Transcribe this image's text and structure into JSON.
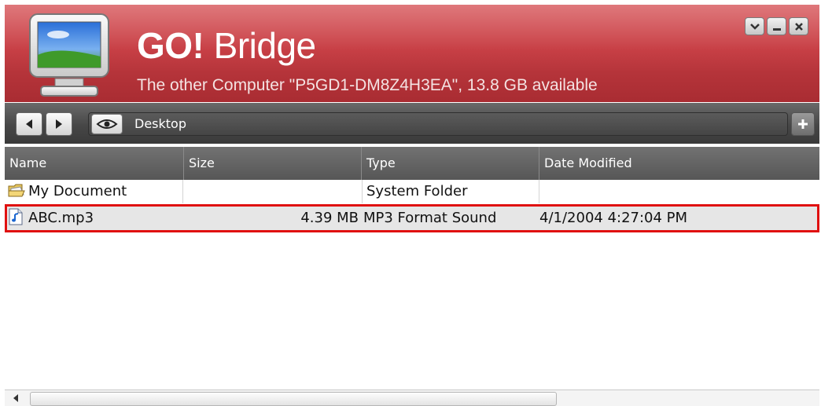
{
  "window": {
    "title_bold": "GO!",
    "title_rest": " Bridge",
    "subtitle": "The other Computer \"P5GD1-DM8Z4H3EA\", 13.8 GB available",
    "accent_color": "#c84046"
  },
  "toolbar": {
    "path": "Desktop"
  },
  "columns": [
    {
      "label": "Name"
    },
    {
      "label": "Size"
    },
    {
      "label": "Type"
    },
    {
      "label": "Date Modified"
    }
  ],
  "rows": [
    {
      "name": "My Document",
      "size": "",
      "type": "System Folder",
      "date": "",
      "icon": "folder-icon"
    },
    {
      "name": "ABC.mp3",
      "size": "4.39 MB",
      "type": "MP3 Format Sound",
      "date": "4/1/2004 4:27:04 PM",
      "icon": "audio-file-icon"
    }
  ]
}
